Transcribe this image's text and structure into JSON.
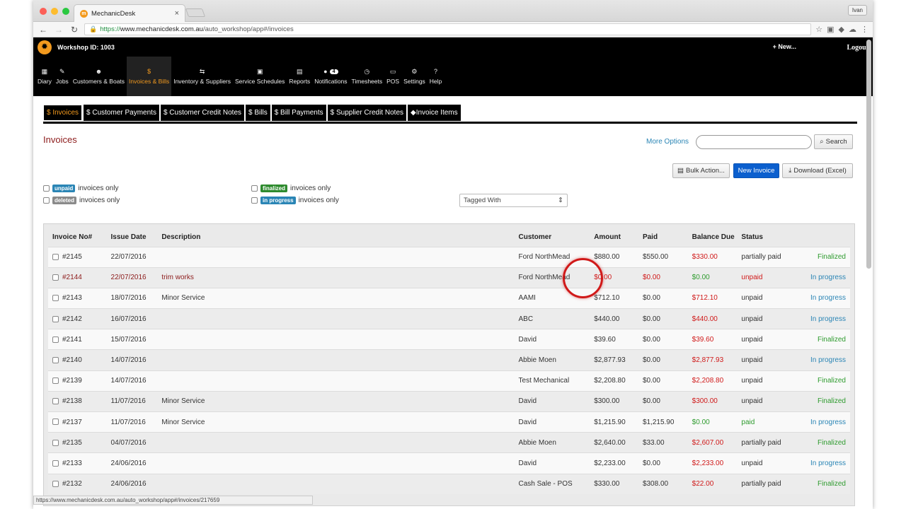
{
  "browser": {
    "tab_title": "MechanicDesk",
    "url_scheme": "https://",
    "url_host": "www.mechanicdesk.com.au",
    "url_path": "/auto_workshop/app#/invoices",
    "user": "Ivan",
    "status_url": "https://www.mechanicdesk.com.au/auto_workshop/app#/invoices/217659"
  },
  "header": {
    "workshop": "Workshop ID: 1003",
    "new": "+ New...",
    "logout": "Logout"
  },
  "nav": [
    {
      "icon": "▦",
      "label": "Diary"
    },
    {
      "icon": "✎",
      "label": "Jobs"
    },
    {
      "icon": "☻",
      "label": "Customers & Boats"
    },
    {
      "icon": "$",
      "label": "Invoices & Bills"
    },
    {
      "icon": "⇆",
      "label": "Inventory & Suppliers"
    },
    {
      "icon": "▣",
      "label": "Service Schedules"
    },
    {
      "icon": "▤",
      "label": "Reports"
    },
    {
      "icon": "●",
      "label": "Notifications",
      "badge": "4"
    },
    {
      "icon": "◷",
      "label": "Timesheets"
    },
    {
      "icon": "▭",
      "label": "POS"
    },
    {
      "icon": "⚙",
      "label": "Settings"
    },
    {
      "icon": "?",
      "label": "Help"
    }
  ],
  "subnav": [
    "$ Invoices",
    "$ Customer Payments",
    "$ Customer Credit Notes",
    "$ Bills",
    "$ Bill Payments",
    "$ Supplier Credit Notes",
    "Invoice Items"
  ],
  "page": {
    "title": "Invoices",
    "more_options": "More Options",
    "search_btn": "Search",
    "bulk": "Bulk Action...",
    "new_invoice": "New Invoice",
    "download": "Download (Excel)",
    "tagged_with": "Tagged With"
  },
  "filters": {
    "unpaid_label": "unpaid",
    "unpaid_text": "invoices only",
    "deleted_label": "deleted",
    "deleted_text": "invoices only",
    "finalized_label": "finalized",
    "finalized_text": "invoices only",
    "progress_label": "in progress",
    "progress_text": "invoices only"
  },
  "table": {
    "headers": [
      "Invoice No#",
      "Issue Date",
      "Description",
      "Customer",
      "Amount",
      "Paid",
      "Balance Due",
      "Status",
      ""
    ],
    "rows": [
      {
        "no": "#2145",
        "date": "22/07/2016",
        "desc": "",
        "cust": "Ford NorthMead",
        "amount": "$880.00",
        "paid": "$550.00",
        "bal": "$330.00",
        "bal_c": "red",
        "status": "partially paid",
        "status_c": "",
        "stage": "Finalized",
        "stage_c": "green",
        "deleted": false
      },
      {
        "no": "#2144",
        "date": "22/07/2016",
        "desc": "trim works",
        "cust": "Ford NorthMead",
        "amount": "$0.00",
        "paid": "$0.00",
        "bal": "$0.00",
        "bal_c": "green",
        "status": "unpaid",
        "status_c": "red",
        "stage": "In progress",
        "stage_c": "blue",
        "deleted": true
      },
      {
        "no": "#2143",
        "date": "18/07/2016",
        "desc": "Minor Service",
        "cust": "AAMI",
        "amount": "$712.10",
        "paid": "$0.00",
        "bal": "$712.10",
        "bal_c": "red",
        "status": "unpaid",
        "status_c": "",
        "stage": "In progress",
        "stage_c": "blue",
        "deleted": false
      },
      {
        "no": "#2142",
        "date": "16/07/2016",
        "desc": "",
        "cust": "ABC",
        "amount": "$440.00",
        "paid": "$0.00",
        "bal": "$440.00",
        "bal_c": "red",
        "status": "unpaid",
        "status_c": "",
        "stage": "In progress",
        "stage_c": "blue",
        "deleted": false
      },
      {
        "no": "#2141",
        "date": "15/07/2016",
        "desc": "",
        "cust": "David",
        "amount": "$39.60",
        "paid": "$0.00",
        "bal": "$39.60",
        "bal_c": "red",
        "status": "unpaid",
        "status_c": "",
        "stage": "Finalized",
        "stage_c": "green",
        "deleted": false
      },
      {
        "no": "#2140",
        "date": "14/07/2016",
        "desc": "",
        "cust": "Abbie Moen",
        "amount": "$2,877.93",
        "paid": "$0.00",
        "bal": "$2,877.93",
        "bal_c": "red",
        "status": "unpaid",
        "status_c": "",
        "stage": "In progress",
        "stage_c": "blue",
        "deleted": false
      },
      {
        "no": "#2139",
        "date": "14/07/2016",
        "desc": "",
        "cust": "Test Mechanical",
        "amount": "$2,208.80",
        "paid": "$0.00",
        "bal": "$2,208.80",
        "bal_c": "red",
        "status": "unpaid",
        "status_c": "",
        "stage": "Finalized",
        "stage_c": "green",
        "deleted": false
      },
      {
        "no": "#2138",
        "date": "11/07/2016",
        "desc": "Minor Service",
        "cust": "David",
        "amount": "$300.00",
        "paid": "$0.00",
        "bal": "$300.00",
        "bal_c": "red",
        "status": "unpaid",
        "status_c": "",
        "stage": "Finalized",
        "stage_c": "green",
        "deleted": false
      },
      {
        "no": "#2137",
        "date": "11/07/2016",
        "desc": "Minor Service",
        "cust": "David",
        "amount": "$1,215.90",
        "paid": "$1,215.90",
        "bal": "$0.00",
        "bal_c": "green",
        "status": "paid",
        "status_c": "green",
        "stage": "In progress",
        "stage_c": "blue",
        "deleted": false
      },
      {
        "no": "#2135",
        "date": "04/07/2016",
        "desc": "",
        "cust": "Abbie Moen",
        "amount": "$2,640.00",
        "paid": "$33.00",
        "bal": "$2,607.00",
        "bal_c": "red",
        "status": "partially paid",
        "status_c": "",
        "stage": "Finalized",
        "stage_c": "green",
        "deleted": false
      },
      {
        "no": "#2133",
        "date": "24/06/2016",
        "desc": "",
        "cust": "David",
        "amount": "$2,233.00",
        "paid": "$0.00",
        "bal": "$2,233.00",
        "bal_c": "red",
        "status": "unpaid",
        "status_c": "",
        "stage": "In progress",
        "stage_c": "blue",
        "deleted": false
      },
      {
        "no": "#2132",
        "date": "24/06/2016",
        "desc": "",
        "cust": "Cash Sale - POS",
        "amount": "$330.00",
        "paid": "$308.00",
        "bal": "$22.00",
        "bal_c": "red",
        "status": "partially paid",
        "status_c": "",
        "stage": "Finalized",
        "stage_c": "green",
        "deleted": false
      }
    ]
  }
}
